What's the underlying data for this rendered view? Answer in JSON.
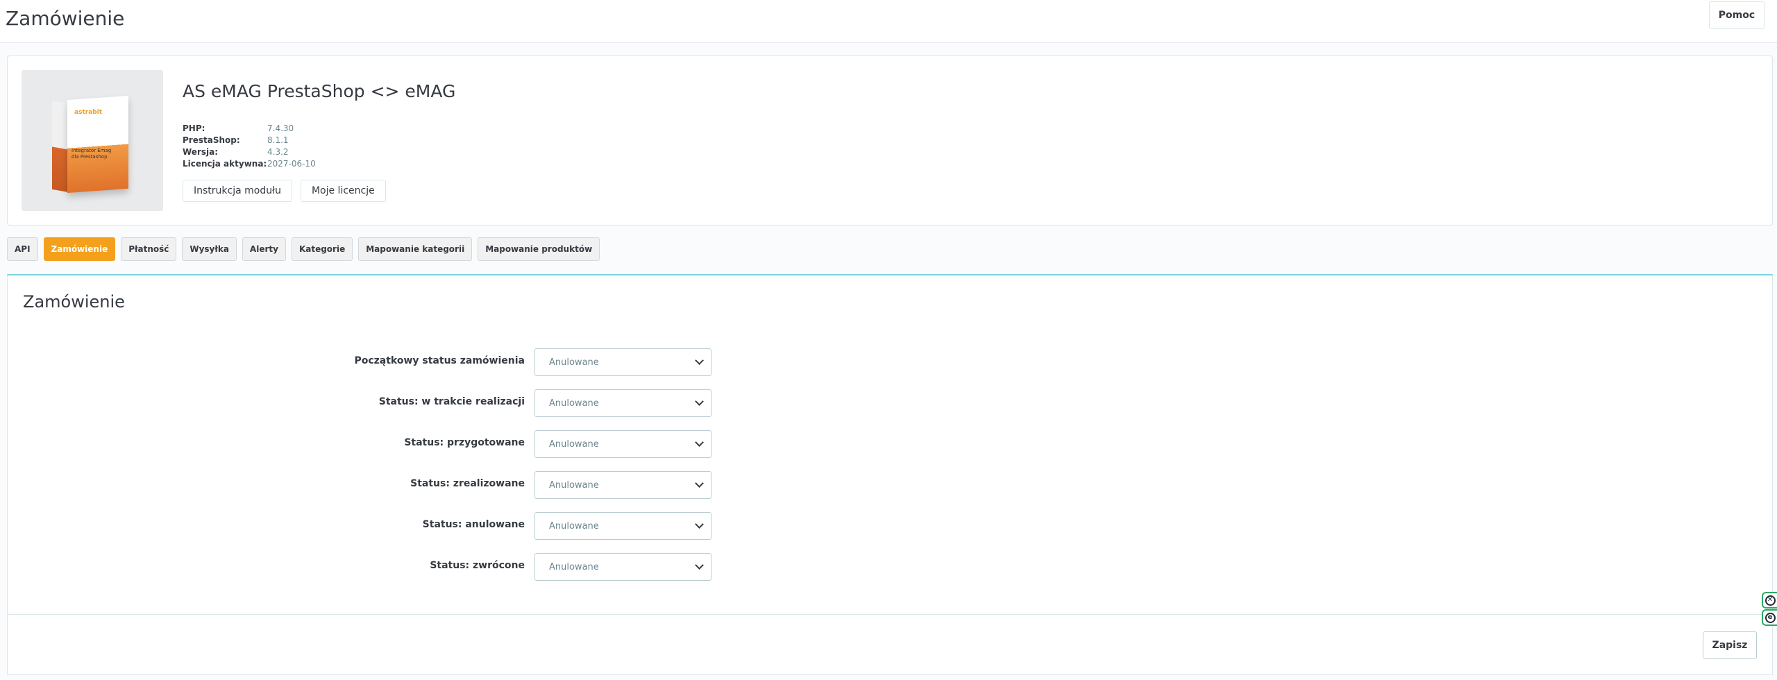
{
  "header": {
    "title": "Zamówienie",
    "help_label": "Pomoc"
  },
  "module": {
    "name": "AS eMAG PrestaShop <> eMAG",
    "image": {
      "brand": "astrabit",
      "caption_line1": "Integrator Emag",
      "caption_line2": "dla Prestashop"
    },
    "info": [
      {
        "label": "PHP:",
        "value": "7.4.30"
      },
      {
        "label": "PrestaShop:",
        "value": "8.1.1"
      },
      {
        "label": "Wersja:",
        "value": "4.3.2"
      },
      {
        "label": "Licencja aktywna:",
        "value": "2027-06-10"
      }
    ],
    "buttons": {
      "instructions": "Instrukcja modułu",
      "licenses": "Moje licencje"
    }
  },
  "tabs": [
    {
      "label": "API",
      "active": false
    },
    {
      "label": "Zamówienie",
      "active": true
    },
    {
      "label": "Płatność",
      "active": false
    },
    {
      "label": "Wysyłka",
      "active": false
    },
    {
      "label": "Alerty",
      "active": false
    },
    {
      "label": "Kategorie",
      "active": false
    },
    {
      "label": "Mapowanie kategorii",
      "active": false
    },
    {
      "label": "Mapowanie produktów",
      "active": false
    }
  ],
  "form": {
    "title": "Zamówienie",
    "fields": [
      {
        "label": "Początkowy status zamówienia",
        "value": "Anulowane"
      },
      {
        "label": "Status: w trakcie realizacji",
        "value": "Anulowane"
      },
      {
        "label": "Status: przygotowane",
        "value": "Anulowane"
      },
      {
        "label": "Status: zrealizowane",
        "value": "Anulowane"
      },
      {
        "label": "Status: anulowane",
        "value": "Anulowane"
      },
      {
        "label": "Status: zwrócone",
        "value": "Anulowane"
      }
    ],
    "save_label": "Zapisz"
  },
  "colors": {
    "accent": "#f5a01d",
    "form_top_border": "#7cd3e0",
    "widget_border": "#2aaa62"
  }
}
